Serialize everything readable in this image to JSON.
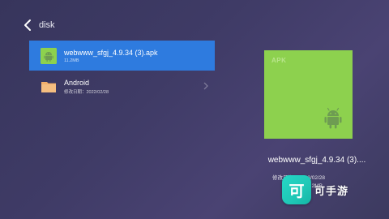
{
  "header": {
    "title": "disk"
  },
  "files": [
    {
      "name": "webwww_sfgj_4.9.34 (3).apk",
      "meta": "11.2MB",
      "type": "apk",
      "selected": true
    },
    {
      "name": "Android",
      "meta": "修改日期：2022/02/28",
      "type": "folder",
      "selected": false
    }
  ],
  "preview": {
    "badge": "APK",
    "name": "webwww_sfgj_4.9.34 (3)....",
    "date": "修改日期：2023/02/28",
    "size": "11.2MB"
  },
  "watermark": {
    "logo_char": "可",
    "text": "可手游"
  },
  "colors": {
    "selection": "#2e7bdf",
    "apk_card": "#8dd14e",
    "folder": "#f2b06c",
    "android": "#6e9c52"
  }
}
